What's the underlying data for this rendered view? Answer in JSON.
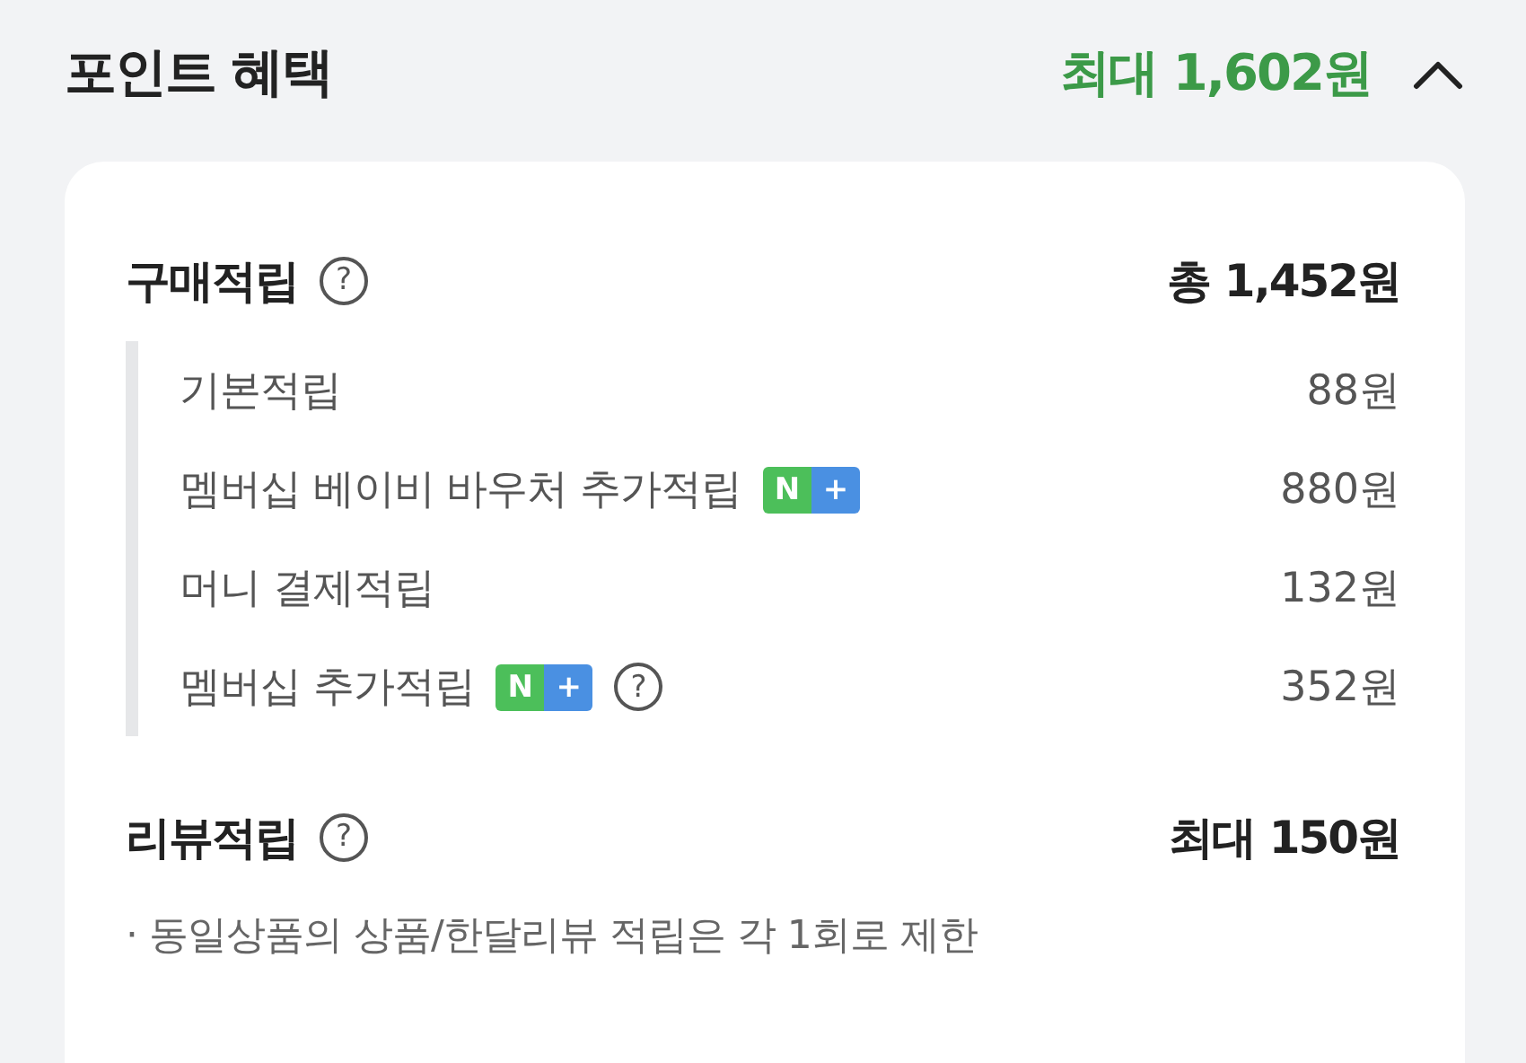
{
  "header": {
    "title": "포인트 혜택",
    "total": "최대 1,602원",
    "expanded": true
  },
  "sections": [
    {
      "title": "구매적립",
      "help": "?",
      "amount": "총 1,452원",
      "items": [
        {
          "label": "기본적립",
          "amount": "88원"
        },
        {
          "label": "멤버십 베이비 바우처 추가적립",
          "badge": {
            "left": "N",
            "right": "+"
          },
          "amount": "880원"
        },
        {
          "label": "머니 결제적립",
          "amount": "132원"
        },
        {
          "label": "멤버십 추가적립",
          "badge": {
            "left": "N",
            "right": "+"
          },
          "help": "?",
          "amount": "352원"
        }
      ]
    },
    {
      "title": "리뷰적립",
      "help": "?",
      "amount": "최대 150원",
      "note": "· 동일상품의 상품/한달리뷰 적립은 각 1회로 제한"
    }
  ]
}
